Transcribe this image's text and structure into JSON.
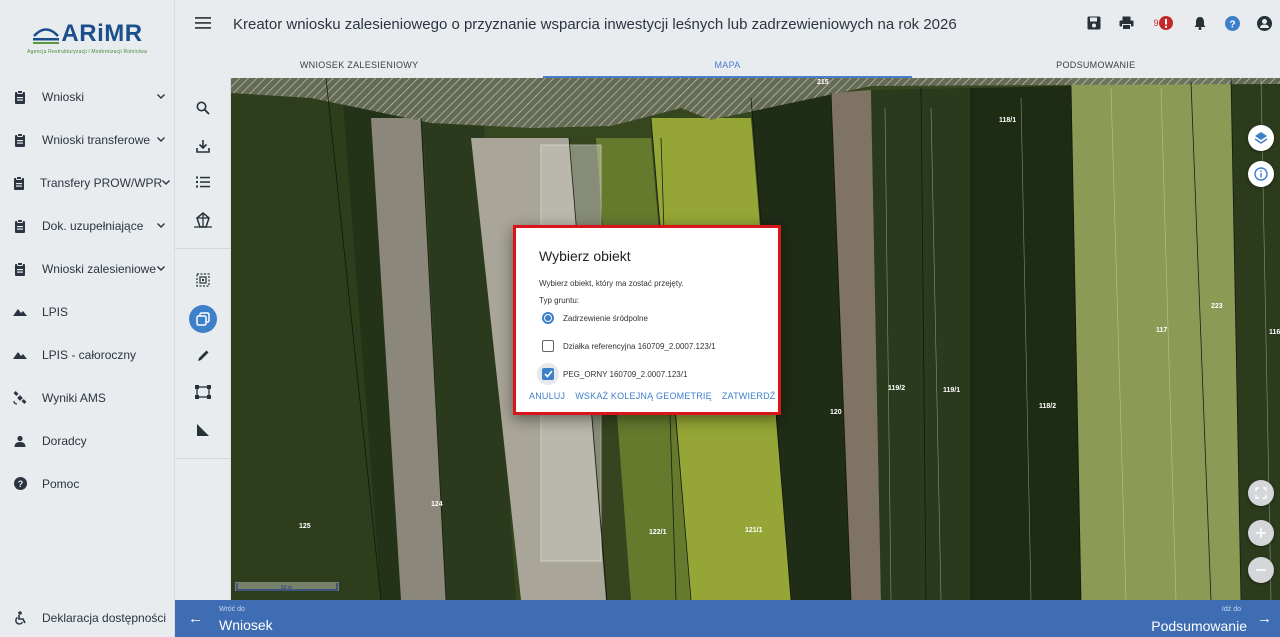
{
  "logo": {
    "name": "ARiMR",
    "subtitle": "Agencja Restrukturyzacji i Modernizacji Rolnictwa"
  },
  "sidebar": {
    "items": [
      {
        "label": "Wnioski",
        "icon": "clipboard-icon",
        "expandable": true
      },
      {
        "label": "Wnioski transferowe",
        "icon": "clipboard-icon",
        "expandable": true
      },
      {
        "label": "Transfery PROW/WPR",
        "icon": "clipboard-icon",
        "expandable": true
      },
      {
        "label": "Dok. uzupełniające",
        "icon": "clipboard-icon",
        "expandable": true
      },
      {
        "label": "Wnioski zalesieniowe",
        "icon": "clipboard-icon",
        "expandable": true
      },
      {
        "label": "LPIS",
        "icon": "mountain-icon",
        "expandable": false
      },
      {
        "label": "LPIS - całoroczny",
        "icon": "mountain-icon",
        "expandable": false
      },
      {
        "label": "Wyniki AMS",
        "icon": "satellite-icon",
        "expandable": false
      },
      {
        "label": "Doradcy",
        "icon": "person-icon",
        "expandable": false
      },
      {
        "label": "Pomoc",
        "icon": "help-icon",
        "expandable": false
      }
    ],
    "footer": "Deklaracja dostępności"
  },
  "header": {
    "title": "Kreator wniosku zalesieniowego o przyznanie wsparcia inwestycji leśnych lub zadrzewieniowych na rok 2026",
    "notification_count": "9"
  },
  "tabs": [
    {
      "label": "WNIOSEK ZALESIENIOWY",
      "active": false
    },
    {
      "label": "MAPA",
      "active": true
    },
    {
      "label": "PODSUMOWANIE",
      "active": false
    }
  ],
  "map": {
    "parcel_labels": [
      "215",
      "118/1",
      "117",
      "223",
      "116",
      "119/2",
      "119/1",
      "118/2",
      "120",
      "124",
      "125",
      "122/1",
      "121/1"
    ],
    "scale_label": "50 m"
  },
  "dialog": {
    "title": "Wybierz obiekt",
    "text": "Wybierz obiekt, który ma zostać przejęty.",
    "type_label": "Typ gruntu:",
    "options": [
      {
        "label": "Zadrzewienie śródpolne",
        "kind": "radio",
        "checked": true
      },
      {
        "label": "Działka referencyjna 160709_2.0007.123/1",
        "kind": "checkbox",
        "checked": false
      },
      {
        "label": "PEG_ORNY 160709_2.0007.123/1",
        "kind": "checkbox",
        "checked": true
      }
    ],
    "actions": {
      "cancel": "ANULUJ",
      "next_geometry": "WSKAŻ KOLEJNĄ GEOMETRIĘ",
      "confirm": "ZATWIERDŹ"
    }
  },
  "bottom": {
    "back_small": "Wróć do",
    "back_big": "Wniosek",
    "next_small": "Idź do",
    "next_big": "Podsumowanie"
  },
  "colors": {
    "accent": "#3d7fc9",
    "bottom_bar": "#3f6db3",
    "highlight_border": "#d9141b",
    "alert": "#c62828"
  }
}
